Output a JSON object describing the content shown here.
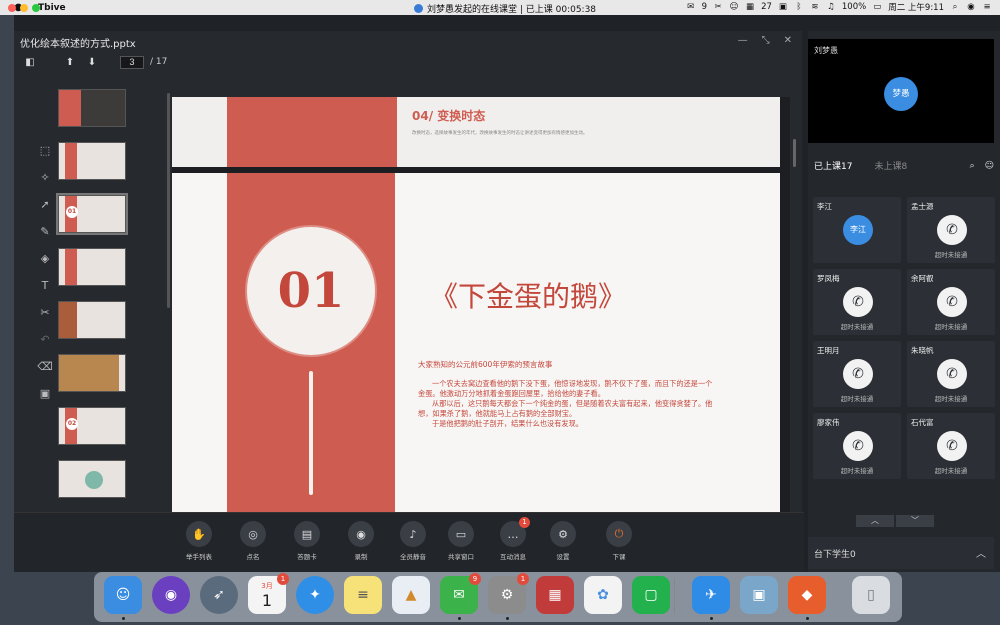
{
  "menubar": {
    "app_name": "Tbive",
    "center_text": "刘梦愚发起的在线课堂 | 已上课 00:05:38",
    "tray": {
      "wechat_count": "9",
      "calendar_date": "27",
      "battery": "100%",
      "datetime": "周二 上午9:11"
    }
  },
  "ppt": {
    "filename": "优化绘本叙述的方式.pptx",
    "current_page": "3",
    "total_pages": "/ 17",
    "thumb_nums": [
      "01",
      "02"
    ]
  },
  "slides": {
    "prev": {
      "title": "04/ 变换时态",
      "text": "改换时态，选择故事发生的年代，改换故事发生的时态让讲述变得更加有情感更加生动。"
    },
    "main": {
      "number": "01",
      "heading": "《下金蛋的鹅》",
      "intro": "大家熟知的公元前600年伊索的预言故事",
      "body": [
        "一个农夫去窝边查看他的鹅下没下蛋，他惊讶地发现，鹅不仅下了蛋，而且下的还是一个金蛋。他激动万分地抓着金蛋跑回屋里，拾给他的妻子看。",
        "从那以后，这只鹅每天都会下一个纯金的蛋，但是随着农夫富有起来，他变得贪婪了。他想，如果杀了鹅，他就能马上占有鹅的全部财宝。",
        "于是他把鹅的肚子剖开，结果什么也没有发现。"
      ]
    }
  },
  "controls": [
    {
      "label": "举手列表",
      "icon": "hand-icon",
      "glyph": "✋"
    },
    {
      "label": "点名",
      "icon": "pin-icon",
      "glyph": "◎"
    },
    {
      "label": "答题卡",
      "icon": "card-icon",
      "glyph": "▤"
    },
    {
      "label": "录制",
      "icon": "record-icon",
      "glyph": "◉"
    },
    {
      "label": "全员静音",
      "icon": "mute-icon",
      "glyph": "♪"
    },
    {
      "label": "共享窗口",
      "icon": "share-icon",
      "glyph": "▭"
    },
    {
      "label": "互动消息",
      "icon": "message-icon",
      "glyph": "…",
      "badge": "1"
    },
    {
      "label": "设置",
      "icon": "settings-icon",
      "glyph": "⚙"
    },
    {
      "label": "下课",
      "icon": "power-icon",
      "glyph": "⏻"
    }
  ],
  "right": {
    "teacher_name": "刘梦愚",
    "teacher_avatar": "梦愚",
    "tab_attended": "已上课17",
    "tab_absent": "未上课8",
    "students": [
      {
        "name": "李江",
        "avatar": "李江",
        "status": ""
      },
      {
        "name": "孟士源",
        "avatar": "",
        "status": "超时未接通"
      },
      {
        "name": "罗凤梅",
        "avatar": "",
        "status": "超时未接通"
      },
      {
        "name": "余阿叡",
        "avatar": "",
        "status": "超时未接通"
      },
      {
        "name": "王明月",
        "avatar": "",
        "status": "超时未接通"
      },
      {
        "name": "朱晓帆",
        "avatar": "",
        "status": "超时未接通"
      },
      {
        "name": "廖家伟",
        "avatar": "",
        "status": "超时未接通"
      },
      {
        "name": "石代富",
        "avatar": "",
        "status": "超时未接通"
      }
    ],
    "below_label": "台下学生0"
  },
  "dock": {
    "calendar_month": "3月",
    "calendar_day": "1",
    "badges": {
      "calendar": "1",
      "wechat": "9",
      "prefs": "1"
    }
  },
  "colors": {
    "accent_red": "#cf5c50",
    "avatar_blue": "#3a8de0",
    "badge_red": "#e24b3c"
  }
}
